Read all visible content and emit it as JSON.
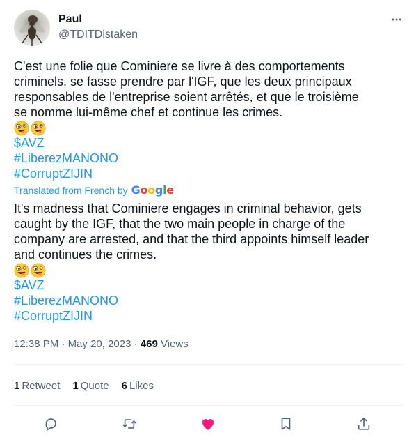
{
  "author": {
    "name": "Paul",
    "handle": "@TDITDistaken",
    "avatar_icon": "fly-photo-avatar"
  },
  "original": {
    "lines": [
      "C'est une folie que Cominiere se livre à des comportements",
      "criminels, se fasse prendre par l'IGF, que les deux principaux",
      "responsables de l'entreprise soient arrêtés, et que le troisième",
      "se nomme lui-même chef et continue les crimes."
    ],
    "emoji": "zany-face-emoji",
    "tags": [
      "$AVZ",
      "#LiberezMANONO",
      "#CorruptZIJIN"
    ]
  },
  "translation_note": {
    "text": "Translated from French by",
    "brand": "Google"
  },
  "translated": {
    "lines": [
      "It's madness that Cominiere engages in criminal behavior, gets",
      "caught by the IGF, that the two main people in charge of the",
      "company are arrested, and that the third appoints himself leader",
      "and continues the crimes."
    ],
    "emoji": "zany-face-emoji",
    "tags": [
      "$AVZ",
      "#LiberezMANONO",
      "#CorruptZIJIN"
    ]
  },
  "meta": {
    "time": "12:38 PM",
    "separator": "·",
    "date": "May 20, 2023",
    "views_count": "469",
    "views_label": "Views"
  },
  "stats": {
    "retweets_count": "1",
    "retweets_label": "Retweet",
    "quotes_count": "1",
    "quotes_label": "Quote",
    "likes_count": "6",
    "likes_label": "Likes"
  },
  "colors": {
    "link": "#1d9bf0",
    "liked": "#f91880",
    "secondary_text": "#536471",
    "icon_gray": "#536471"
  }
}
